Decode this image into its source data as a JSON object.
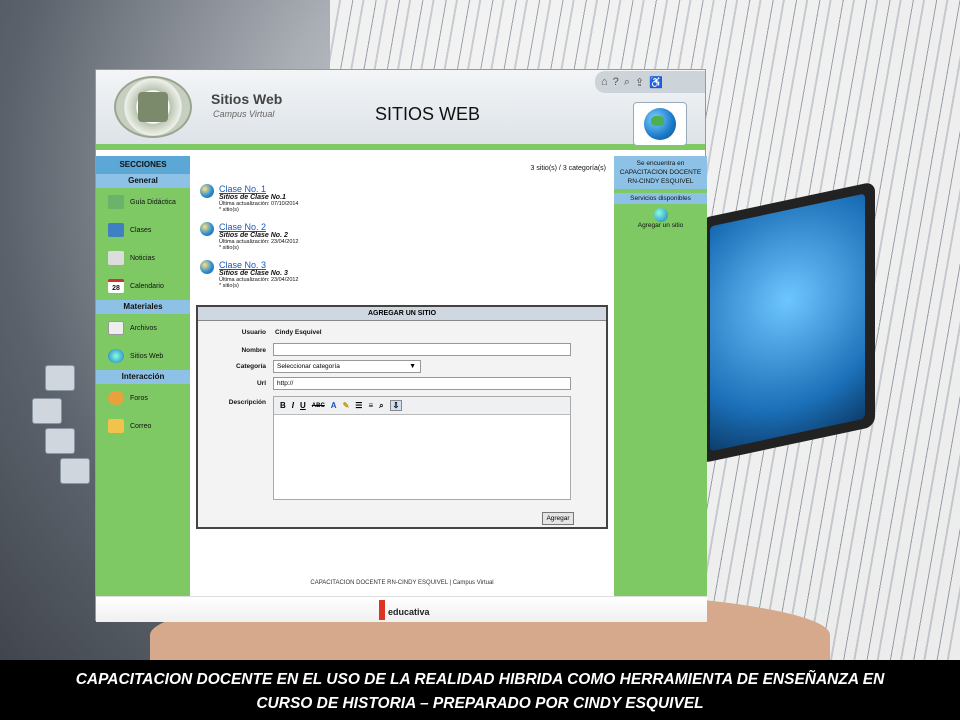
{
  "header": {
    "site_name": "Sitios Web",
    "site_sub": "Campus Virtual",
    "page_title": "SITIOS WEB"
  },
  "toolbar": {
    "icons": [
      "home-icon",
      "help-icon",
      "search-icon",
      "upload-icon",
      "accessibility-icon"
    ]
  },
  "left_nav": {
    "sections_label": "SECCIONES",
    "general_label": "General",
    "general_items": [
      {
        "label": "Guía Didáctica",
        "icon": "book-icon"
      },
      {
        "label": "Clases",
        "icon": "classes-icon"
      },
      {
        "label": "Noticias",
        "icon": "news-icon"
      },
      {
        "label": "Calendario",
        "icon": "calendar-icon",
        "badge": "28"
      }
    ],
    "materials_label": "Materiales",
    "materials_items": [
      {
        "label": "Archivos",
        "icon": "file-icon"
      },
      {
        "label": "Sitios Web",
        "icon": "globe-icon"
      }
    ],
    "interaction_label": "Interacción",
    "interaction_items": [
      {
        "label": "Foros",
        "icon": "forum-icon"
      },
      {
        "label": "Correo",
        "icon": "mail-icon"
      }
    ]
  },
  "main": {
    "counts": "3 sitio(s) / 3 categoría(s)",
    "sites": [
      {
        "title": "Clase No. 1",
        "subtitle": "Sitios de Clase No.1",
        "meta": "Última actualización: 07/10/2014",
        "extra": "* sitio(s)"
      },
      {
        "title": "Clase No. 2",
        "subtitle": "Sitios de Clase No. 2",
        "meta": "Última actualización: 23/04/2012",
        "extra": "* sitio(s)"
      },
      {
        "title": "Clase No. 3",
        "subtitle": "Sitios de Clase No. 3",
        "meta": "Última actualización: 23/04/2012",
        "extra": "* sitio(s)"
      }
    ],
    "form": {
      "title": "AGREGAR UN SITIO",
      "user_label": "Usuario",
      "user_value": "Cindy Esquivel",
      "name_label": "Nombre",
      "name_value": "",
      "category_label": "Categoría",
      "category_value": "Seleccionar categoría",
      "url_label": "Url",
      "url_value": "http://",
      "desc_label": "Descripción",
      "submit_label": "Agregar"
    },
    "footer": "CAPACITACION DOCENTE RN-CINDY ESQUIVEL | Campus Virtual"
  },
  "right_panel": {
    "location_text": "Se encuentra en CAPACITACION DOCENTE RN-CINDY ESQUIVEL",
    "services_label": "Servicios disponibles",
    "add_label": "Agregar un sitio"
  },
  "branding": {
    "powered_by": "educativa"
  },
  "caption": {
    "line1": "CAPACITACION DOCENTE EN EL USO DE LA REALIDAD HIBRIDA COMO HERRAMIENTA DE ENSEÑANZA EN",
    "line2": "CURSO DE HISTORIA – PREPARADO POR CINDY ESQUIVEL"
  }
}
